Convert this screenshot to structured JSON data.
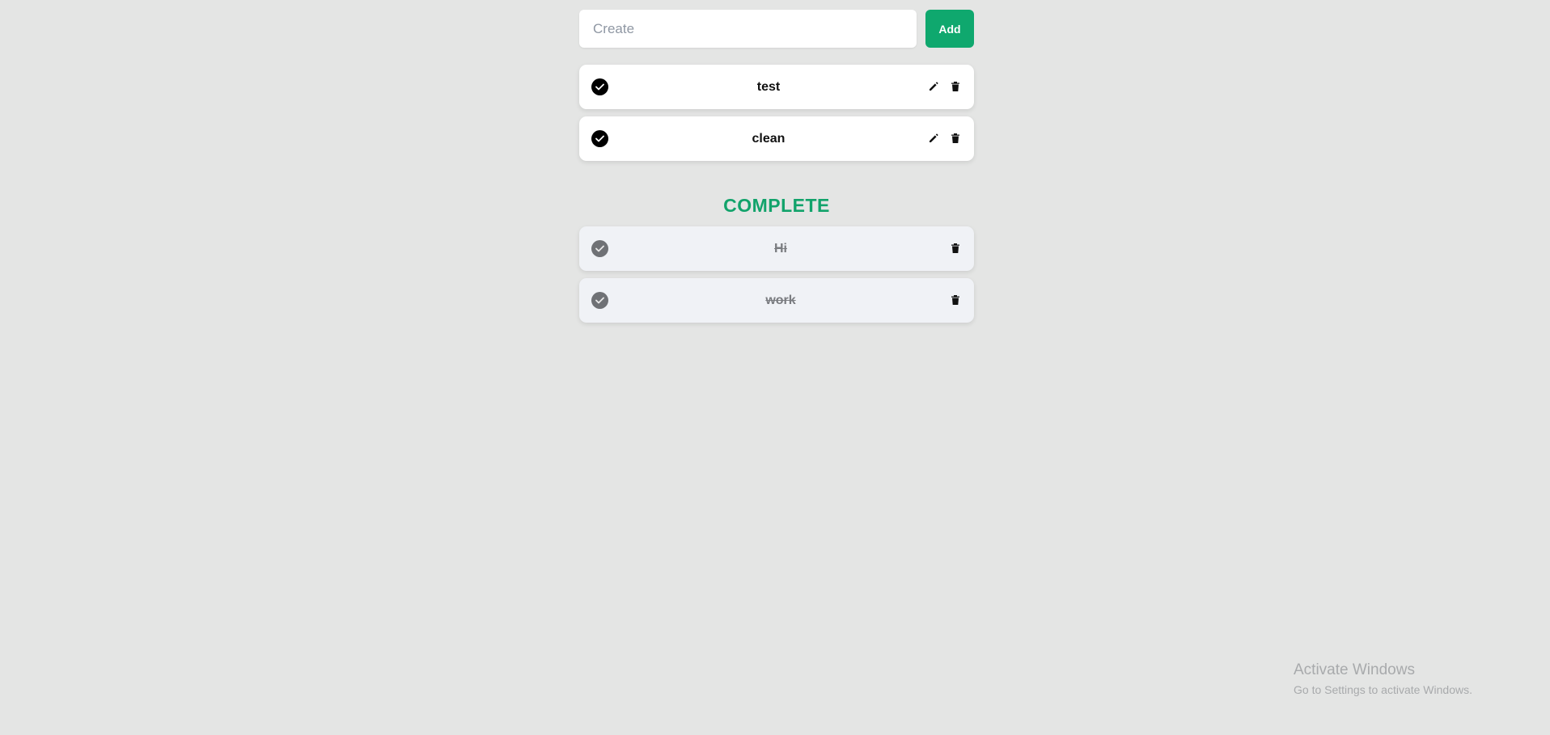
{
  "create": {
    "placeholder": "Create",
    "value": "",
    "add_label": "Add"
  },
  "todo_items": [
    {
      "label": "test",
      "check_icon": "check-circle-icon",
      "edit_icon": "pencil-icon",
      "delete_icon": "trash-icon"
    },
    {
      "label": "clean",
      "check_icon": "check-circle-icon",
      "edit_icon": "pencil-icon",
      "delete_icon": "trash-icon"
    }
  ],
  "complete_section": {
    "title": "COMPLETE",
    "items": [
      {
        "label": "Hi",
        "check_icon": "check-circle-icon",
        "delete_icon": "trash-icon"
      },
      {
        "label": "work",
        "check_icon": "check-circle-icon",
        "delete_icon": "trash-icon"
      }
    ]
  },
  "watermark": {
    "line1": "Activate Windows",
    "line2": "Go to Settings to activate Windows."
  },
  "colors": {
    "background": "#e4e5e4",
    "accent": "#0fa86e",
    "complete_title": "#12a36b",
    "done_card": "#f0f2f6",
    "done_check": "#6f7175"
  }
}
